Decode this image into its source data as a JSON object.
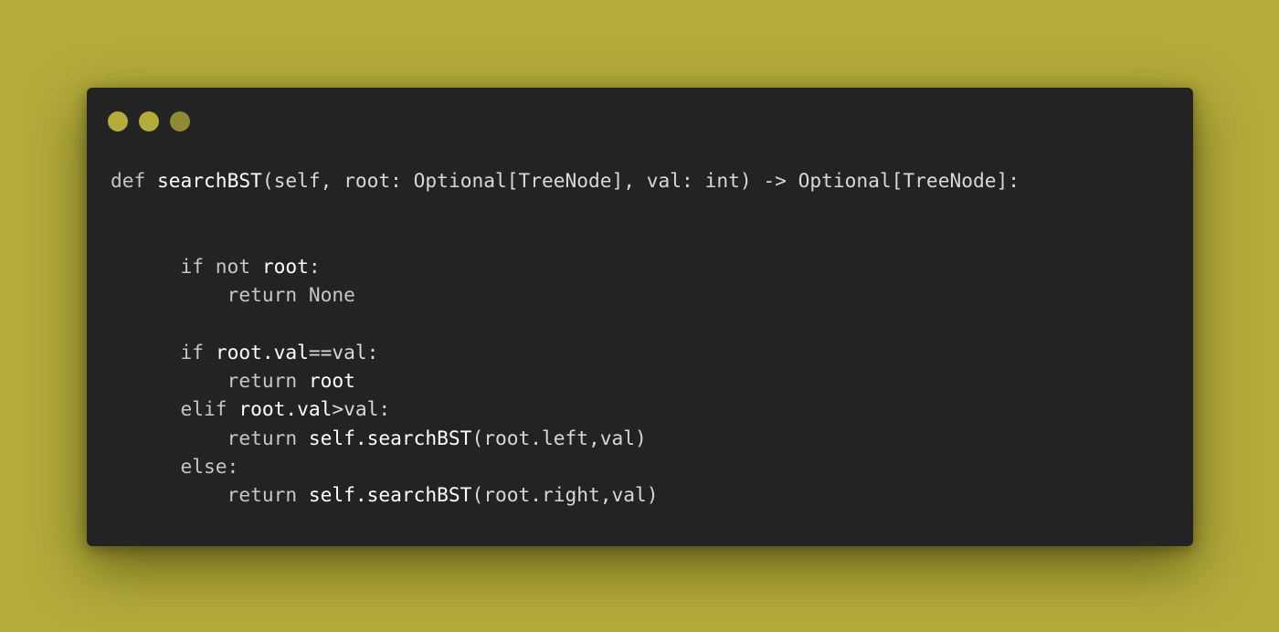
{
  "window": {
    "traffic_lights": [
      {
        "name": "close",
        "color": "#b3ab3a"
      },
      {
        "name": "minimize",
        "color": "#b3ab3a"
      },
      {
        "name": "maximize",
        "color": "#8f8a33"
      }
    ]
  },
  "code": {
    "lines": [
      [
        {
          "t": "def ",
          "c": "kw"
        },
        {
          "t": "searchBST",
          "c": "bright"
        },
        {
          "t": "(self, root: Optional[TreeNode], val: int) -> Optional[TreeNode]:",
          "c": "plain"
        }
      ],
      [],
      [],
      [
        {
          "t": "      if not ",
          "c": "kw"
        },
        {
          "t": "root",
          "c": "bright"
        },
        {
          "t": ":",
          "c": "plain"
        }
      ],
      [
        {
          "t": "          return None",
          "c": "kw"
        }
      ],
      [],
      [
        {
          "t": "      if ",
          "c": "kw"
        },
        {
          "t": "root.val",
          "c": "bright"
        },
        {
          "t": "==val:",
          "c": "plain"
        }
      ],
      [
        {
          "t": "          return ",
          "c": "kw"
        },
        {
          "t": "root",
          "c": "bright"
        }
      ],
      [
        {
          "t": "      elif ",
          "c": "kw"
        },
        {
          "t": "root.val",
          "c": "bright"
        },
        {
          "t": ">val:",
          "c": "plain"
        }
      ],
      [
        {
          "t": "          return ",
          "c": "kw"
        },
        {
          "t": "self.searchBST",
          "c": "bright"
        },
        {
          "t": "(root.left,val)",
          "c": "plain"
        }
      ],
      [
        {
          "t": "      else:",
          "c": "kw"
        }
      ],
      [
        {
          "t": "          return ",
          "c": "kw"
        },
        {
          "t": "self.searchBST",
          "c": "bright"
        },
        {
          "t": "(root.right,val)",
          "c": "plain"
        }
      ]
    ]
  }
}
